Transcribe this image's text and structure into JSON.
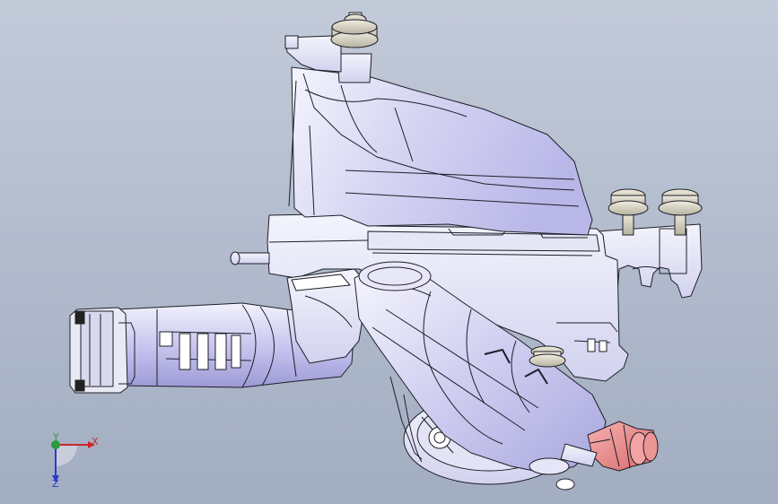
{
  "viewport": {
    "background_top": "#c3cad9",
    "background_bottom": "#a3adc1"
  },
  "model": {
    "part_fill": "#eef0fb",
    "part_shade": "#c9c8ef",
    "edge_color": "#1e1e28",
    "accent_fill": "#e58c8c",
    "icons": [
      "gear-bolt-icon",
      "hose-connector-icon",
      "electrical-plug-icon"
    ]
  },
  "triad": {
    "x_label": "X",
    "y_label": "Y",
    "z_label": "Z",
    "x_color": "#c8282a",
    "y_color": "#2a9a3a",
    "z_color": "#2a3ac8"
  }
}
